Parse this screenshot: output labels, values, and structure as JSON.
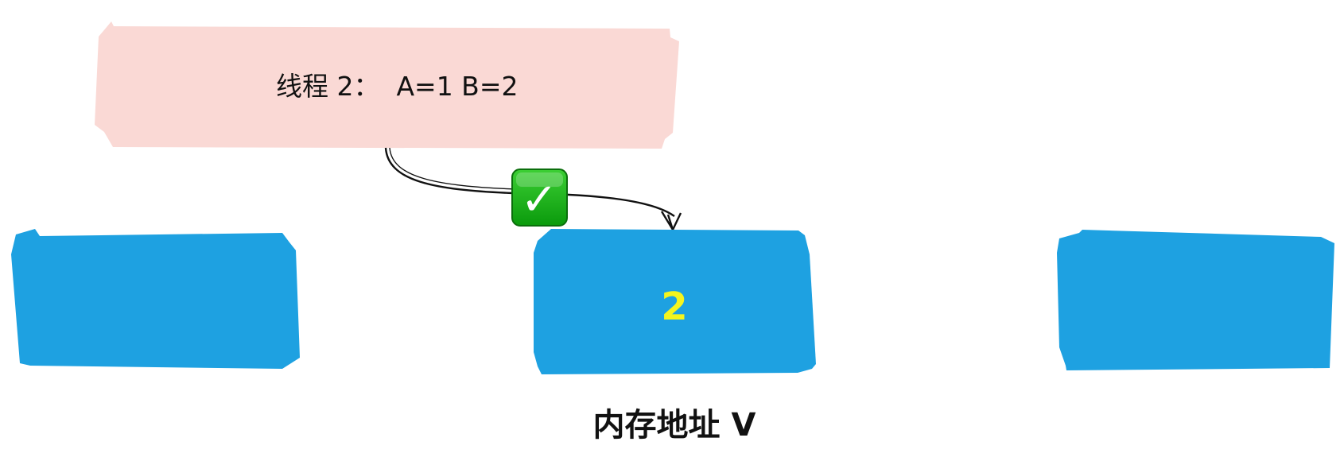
{
  "thread_note": {
    "label": "线程 2：  A=1 B=2",
    "fill_color": "#fad9d5"
  },
  "memory_cells": [
    {
      "id": "left",
      "value": ""
    },
    {
      "id": "center",
      "value": "2"
    },
    {
      "id": "right",
      "value": ""
    }
  ],
  "cell_color": "#1ea1e1",
  "value_color": "#f5f51e",
  "memory_address_label": "内存地址 V",
  "check_badge": {
    "icon": "check-mark-icon",
    "glyph": "✓",
    "color": "#1aad19"
  }
}
